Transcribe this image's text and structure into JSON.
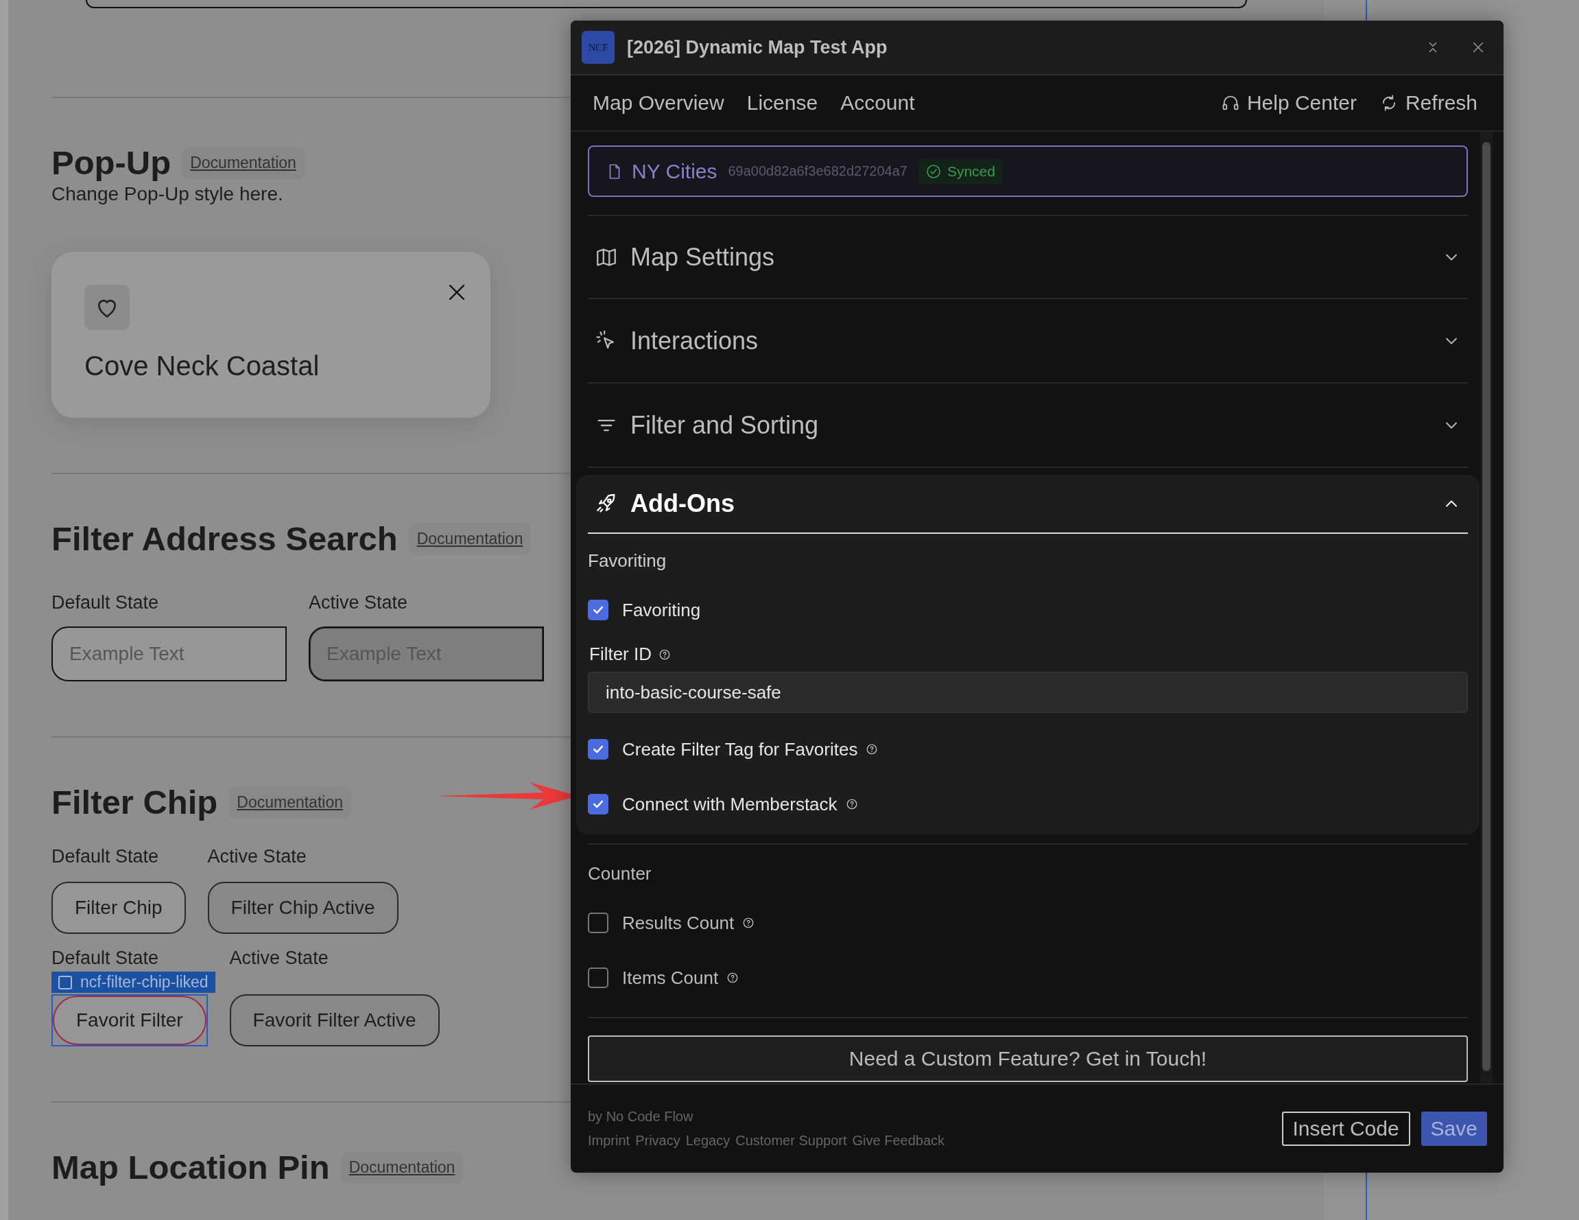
{
  "page": {
    "top_field": {
      "kind": "field"
    },
    "popup_section": {
      "title": "Pop-Up",
      "doc_link": "Documentation",
      "description": "Change Pop-Up style here.",
      "card": {
        "title": "Cove Neck Coastal"
      }
    },
    "address_section": {
      "title": "Filter Address Search",
      "doc_link": "Documentation",
      "states": [
        {
          "label": "Default State",
          "placeholder": "Example Text",
          "active": false
        },
        {
          "label": "Active State",
          "placeholder": "Example Text",
          "active": true
        }
      ]
    },
    "chip_section": {
      "title": "Filter Chip",
      "doc_link": "Documentation",
      "rows": [
        {
          "states": [
            {
              "label": "Default State",
              "chip": "Filter Chip",
              "active": false
            },
            {
              "label": "Active State",
              "chip": "Filter Chip Active",
              "active": true
            }
          ]
        },
        {
          "states": [
            {
              "label": "Default State",
              "chip": "Favorit Filter",
              "active": false,
              "inspected": true
            },
            {
              "label": "Active State",
              "chip": "Favorit Filter Active",
              "active": true,
              "inspected": false
            }
          ],
          "inspector_tag": {
            "label": "ncf-filter-chip-liked",
            "checked": false
          }
        }
      ]
    },
    "pin_section": {
      "title": "Map Location Pin",
      "doc_link": "Documentation"
    }
  },
  "app": {
    "logo": "NCF",
    "title": "[2026] Dynamic Map Test App",
    "nav": [
      {
        "label": "Map Overview"
      },
      {
        "label": "License"
      },
      {
        "label": "Account"
      }
    ],
    "actions": [
      {
        "label": "Help Center",
        "kind": "help"
      },
      {
        "label": "Refresh",
        "kind": "refresh"
      }
    ],
    "project": {
      "name": "NY Cities",
      "id": "69a00d82a6f3e682d27204a7",
      "status": "Synced"
    },
    "sections": [
      {
        "title": "Map Settings",
        "kind": "map",
        "expanded": false
      },
      {
        "title": "Interactions",
        "kind": "pointer",
        "expanded": false
      },
      {
        "title": "Filter and Sorting",
        "kind": "filter",
        "expanded": false
      },
      {
        "title": "Add-Ons",
        "kind": "rocket",
        "expanded": true,
        "groups": [
          {
            "title": "Favoriting",
            "highlighted": true,
            "items": [
              {
                "kind": "checkbox",
                "label": "Favoriting",
                "checked": true,
                "help": false
              },
              {
                "kind": "field",
                "label": "Filter ID",
                "help": true,
                "value": "into-basic-course-safe"
              },
              {
                "kind": "checkbox",
                "label": "Create Filter Tag for Favorites",
                "checked": true,
                "help": true
              },
              {
                "kind": "checkbox",
                "label": "Connect with Memberstack",
                "checked": true,
                "help": true
              }
            ]
          },
          {
            "title": "Counter",
            "highlighted": false,
            "items": [
              {
                "kind": "checkbox",
                "label": "Results Count",
                "checked": false,
                "help": true
              },
              {
                "kind": "checkbox",
                "label": "Items Count",
                "checked": false,
                "help": true
              }
            ]
          }
        ]
      }
    ],
    "contact_button": "Need a Custom Feature? Get in Touch!",
    "footer": {
      "credit": "by No Code Flow",
      "links": [
        {
          "label": "Imprint"
        },
        {
          "label": "Privacy"
        },
        {
          "label": "Legacy"
        },
        {
          "label": "Customer Support"
        },
        {
          "label": "Give Feedback"
        }
      ],
      "buttons": [
        {
          "label": "Insert Code",
          "kind": "secondary"
        },
        {
          "label": "Save",
          "kind": "primary"
        }
      ]
    }
  }
}
